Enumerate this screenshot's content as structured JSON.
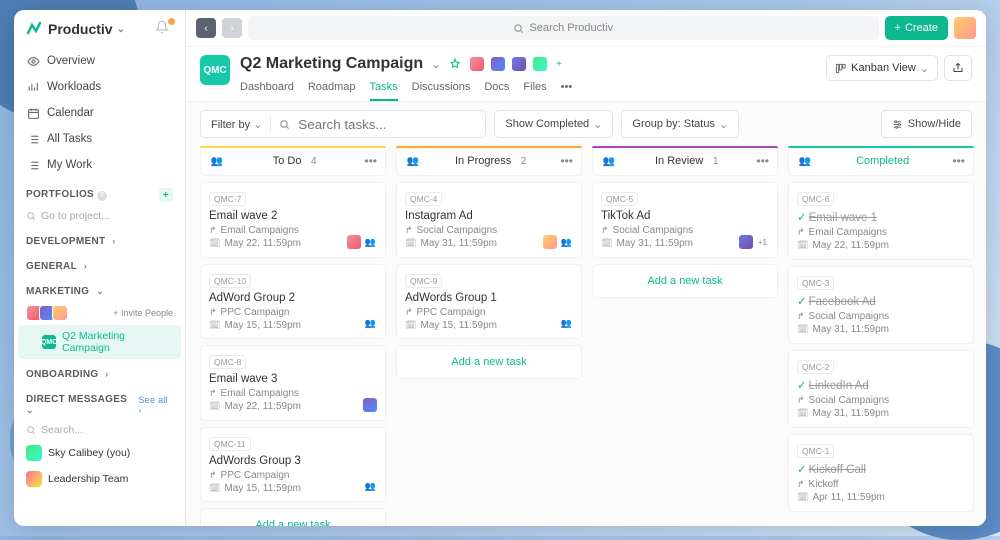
{
  "brand": "Productiv",
  "search": {
    "placeholder": "Search Productiv"
  },
  "createBtn": "Create",
  "nav": [
    {
      "label": "Overview",
      "icon": "eye"
    },
    {
      "label": "Workloads",
      "icon": "bars"
    },
    {
      "label": "Calendar",
      "icon": "calendar"
    },
    {
      "label": "All Tasks",
      "icon": "list"
    },
    {
      "label": "My Work",
      "icon": "list"
    }
  ],
  "portfoliosHdr": "PORTFOLIOS",
  "goToProject": "Go to project...",
  "sections": {
    "development": "DEVELOPMENT",
    "general": "GENERAL",
    "marketing": "MARKETING",
    "onboarding": "ONBOARDING",
    "directMessages": "DIRECT MESSAGES"
  },
  "invite": "+ Invite People",
  "seeAll": "See all ›",
  "dmSearch": "Search...",
  "projectName": "Q2 Marketing Campaign",
  "projectKey": "QMC",
  "dms": [
    "Sky Calibey (you)",
    "Leadership Team"
  ],
  "project": {
    "title": "Q2 Marketing Campaign",
    "tabs": [
      "Dashboard",
      "Roadmap",
      "Tasks",
      "Discussions",
      "Docs",
      "Files"
    ],
    "activeTab": 2,
    "viewLabel": "Kanban View"
  },
  "toolbar": {
    "filter": "Filter by",
    "searchPlaceholder": "Search tasks...",
    "showCompleted": "Show Completed",
    "groupBy": "Group by:",
    "groupVal": "Status",
    "showHide": "Show/Hide"
  },
  "columns": [
    {
      "key": "todo",
      "title": "To Do",
      "count": 4
    },
    {
      "key": "prog",
      "title": "In Progress",
      "count": 2
    },
    {
      "key": "rev",
      "title": "In Review",
      "count": 1
    },
    {
      "key": "done",
      "title": "Completed",
      "count": null
    }
  ],
  "addTask": "Add a new task",
  "cards": {
    "todo": [
      {
        "id": "QMC-7",
        "title": "Email wave 2",
        "sub": "Email Campaigns",
        "date": "May 22, 11:59pm",
        "avatars": [
          "ava-1"
        ],
        "member": true
      },
      {
        "id": "QMC-10",
        "title": "AdWord Group 2",
        "sub": "PPC Campaign",
        "date": "May 15, 11:59pm",
        "avatars": [],
        "member": true
      },
      {
        "id": "QMC-8",
        "title": "Email wave 3",
        "sub": "Email Campaigns",
        "date": "May 22, 11:59pm",
        "avatars": [
          "ava-2"
        ],
        "member": false
      },
      {
        "id": "QMC-11",
        "title": "AdWords Group 3",
        "sub": "PPC Campaign",
        "date": "May 15, 11:59pm",
        "avatars": [],
        "member": true
      }
    ],
    "prog": [
      {
        "id": "QMC-4",
        "title": "Instagram Ad",
        "sub": "Social Campaigns",
        "date": "May 31, 11:59pm",
        "avatars": [
          "ava-3"
        ],
        "member": true
      },
      {
        "id": "QMC-9",
        "title": "AdWords Group 1",
        "sub": "PPC Campaign",
        "date": "May 15, 11:59pm",
        "avatars": [],
        "member": true
      }
    ],
    "rev": [
      {
        "id": "QMC-5",
        "title": "TikTok Ad",
        "sub": "Social Campaigns",
        "date": "May 31, 11:59pm",
        "avatars": [
          "ava-4"
        ],
        "plus": "+1",
        "member": false
      }
    ],
    "done": [
      {
        "id": "QMC-6",
        "title": "Email wave 1",
        "sub": "Email Campaigns",
        "date": "May 22, 11:59pm",
        "done": true
      },
      {
        "id": "QMC-3",
        "title": "Facebook Ad",
        "sub": "Social Campaigns",
        "date": "May 31, 11:59pm",
        "done": true
      },
      {
        "id": "QMC-2",
        "title": "LinkedIn Ad",
        "sub": "Social Campaigns",
        "date": "May 31, 11:59pm",
        "done": true
      },
      {
        "id": "QMC-1",
        "title": "Kickoff Call",
        "sub": "Kickoff",
        "date": "Apr 11, 11:59pm",
        "done": true
      }
    ]
  }
}
